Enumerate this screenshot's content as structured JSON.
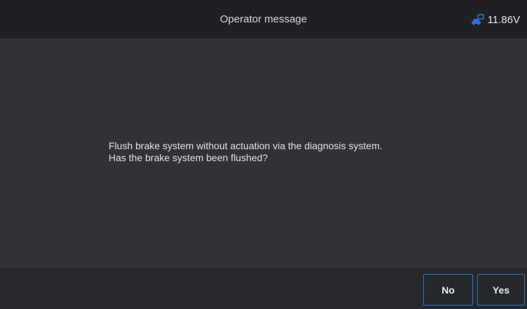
{
  "header": {
    "title": "Operator message",
    "battery_icon": "car-battery-icon",
    "voltage": "11.86V"
  },
  "message": {
    "line1": "Flush brake system without actuation via the diagnosis system.",
    "line2": "Has the brake system been flushed?"
  },
  "footer": {
    "no_label": "No",
    "yes_label": "Yes"
  },
  "colors": {
    "accent": "#2f73d6",
    "header_bg": "#1f2023",
    "content_bg": "#303235",
    "footer_bg": "#26282b"
  }
}
